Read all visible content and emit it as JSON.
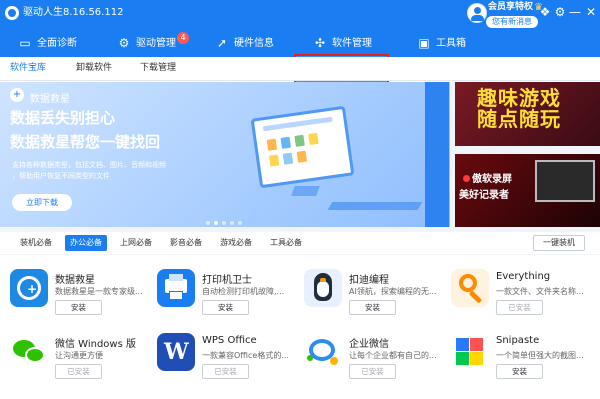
{
  "window": {
    "title": "驱动人生8.16.56.112"
  },
  "account": {
    "vip_label": "会员享特权",
    "message_label": "您有新消息"
  },
  "nav": {
    "items": [
      {
        "label": "全面诊断",
        "icon": "monitor-icon"
      },
      {
        "label": "驱动管理",
        "icon": "gear-icon",
        "badge": "4"
      },
      {
        "label": "硬件信息",
        "icon": "rocket-icon"
      },
      {
        "label": "软件管理",
        "icon": "apps-icon",
        "active": true
      },
      {
        "label": "工具箱",
        "icon": "toolbox-icon"
      }
    ]
  },
  "subnav": {
    "items": [
      "软件宝库",
      "卸载软件",
      "下载管理"
    ],
    "active": "软件宝库"
  },
  "banner": {
    "tag": "数据救星",
    "headline1": "数据丢失别担心",
    "headline2": "数据救星帮您一键找回",
    "desc1": "支持各种数据类型，包括文档、图片、音频和视频",
    "desc2": "，帮助用户恢复不同类型的文件",
    "button": "立即下载"
  },
  "promos": [
    {
      "line1": "趣味游戏",
      "line2": "随点随玩"
    },
    {
      "line1": "傲软录屏",
      "line2": "美好记录者"
    }
  ],
  "categories": {
    "items": [
      "装机必备",
      "办公必备",
      "上网必备",
      "影音必备",
      "游戏必备",
      "工具必备"
    ],
    "active": "办公必备",
    "install_all": "一键装机"
  },
  "apps": [
    {
      "name": "数据救星",
      "desc": "数据救星是一款专家级...",
      "button": "安装",
      "installed": false,
      "icon": "data-rescue-icon",
      "color": "#1e88e5"
    },
    {
      "name": "打印机卫士",
      "desc": "自动检测打印机故障,...",
      "button": "安装",
      "installed": false,
      "icon": "printer-icon",
      "color": "#1a7ef2"
    },
    {
      "name": "扣迪编程",
      "desc": "AI领航，探索编程的无...",
      "button": "安装",
      "installed": false,
      "icon": "penguin-icon",
      "color": "#e8f0ff"
    },
    {
      "name": "Everything",
      "desc": "一款文件、文件夹名称...",
      "button": "已安装",
      "installed": true,
      "icon": "magnifier-icon",
      "color": "#fff3e0"
    },
    {
      "name": "微信 Windows 版",
      "desc": "让沟通更方便",
      "button": "已安装",
      "installed": true,
      "icon": "wechat-icon",
      "color": "#2dc100"
    },
    {
      "name": "WPS Office",
      "desc": "一款兼容Office格式的...",
      "button": "已安装",
      "installed": true,
      "icon": "wps-icon",
      "color": "#1f4fb5"
    },
    {
      "name": "企业微信",
      "desc": "让每个企业都有自己的...",
      "button": "已安装",
      "installed": true,
      "icon": "wecom-icon",
      "color": "#2d8cf0"
    },
    {
      "name": "Snipaste",
      "desc": "一个简单但强大的截图...",
      "button": "安装",
      "installed": false,
      "icon": "snipaste-icon",
      "color": "#ff5252"
    }
  ]
}
